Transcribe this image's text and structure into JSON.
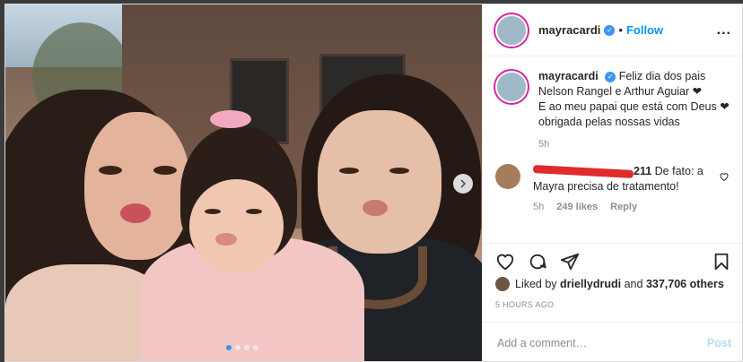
{
  "post": {
    "username": "mayracardi",
    "follow_label": "Follow",
    "dot": "•",
    "more": "...",
    "caption_line1": "Feliz dia dos pais",
    "caption_line2": "Nelson Rangel e Arthur Aguiar ❤",
    "caption_line3": "E ao meu papai que está com Deus ❤",
    "caption_line4": "obrigada pelas nossas vidas",
    "caption_time": "5h"
  },
  "comment": {
    "username_visible": "211",
    "text_line1": " De fato: a",
    "text_line2": "Mayra precisa de tratamento!",
    "time": "5h",
    "likes": "249 likes",
    "reply": "Reply"
  },
  "likes": {
    "prefix": "Liked by ",
    "user": "driellydrudi",
    "and": " and ",
    "count": "337,706 others"
  },
  "timestamp": "5 HOURS AGO",
  "add_comment": {
    "placeholder": "Add a comment…",
    "post_label": "Post"
  },
  "icons": {
    "verified": "✓"
  },
  "colors": {
    "accent": "#0095f6",
    "post_disabled": "#b2dffc",
    "verified": "#3897f0",
    "redaction": "#e02b2b"
  },
  "carousel": {
    "slide_count": 4,
    "active_index": 0
  }
}
